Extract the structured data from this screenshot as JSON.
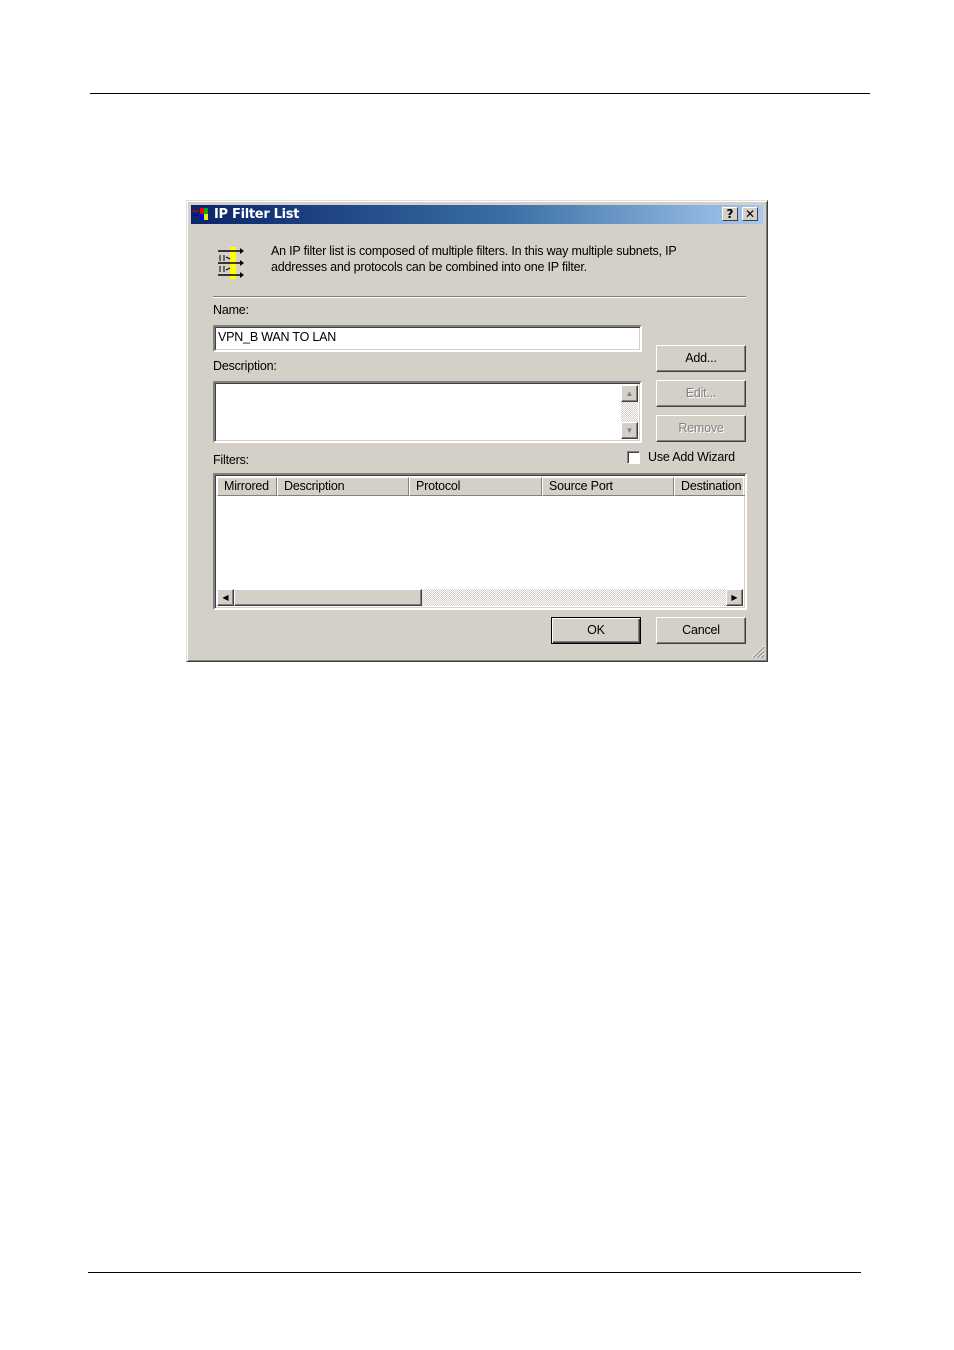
{
  "window": {
    "title": "IP Filter List",
    "help_button": "?",
    "close_button": "✕"
  },
  "intro_text": {
    "line1": "An IP filter list is composed of multiple filters. In this way multiple subnets, IP",
    "line2": "addresses and protocols can be combined into one IP filter."
  },
  "form": {
    "name_label": "Name:",
    "name_value": "VPN_B WAN TO LAN",
    "description_label": "Description:",
    "description_value": "",
    "filters_label": "Filters:",
    "use_add_wizard_label": "Use Add Wizard",
    "use_add_wizard_checked": false
  },
  "buttons": {
    "add": "Add...",
    "edit": "Edit...",
    "remove": "Remove",
    "ok": "OK",
    "cancel": "Cancel"
  },
  "filters_table": {
    "columns": [
      "Mirrored",
      "Description",
      "Protocol",
      "Source Port",
      "Destination"
    ],
    "rows": []
  }
}
